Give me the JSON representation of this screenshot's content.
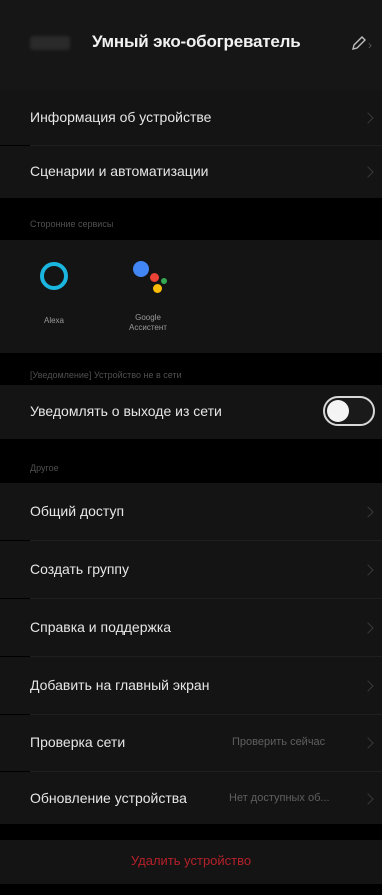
{
  "header": {
    "title": "Умный эко-обогреватель",
    "edit_icon": "pencil-icon",
    "chevron_icon": "chevron-right-icon"
  },
  "menu_top": [
    {
      "label": "Информация об устройстве"
    },
    {
      "label": "Сценарии и автоматизации"
    }
  ],
  "third_party": {
    "section_label": "Сторонние сервисы",
    "services": [
      {
        "name": "Alexa",
        "icon": "alexa-icon"
      },
      {
        "name": "Google\nАссистент",
        "icon": "google-assistant-icon"
      }
    ]
  },
  "notifications": {
    "section_label": "[Уведомление] Устройство не в сети",
    "offline_label": "Уведомлять о выходе из сети",
    "offline_enabled": false
  },
  "other": {
    "section_label": "Другое",
    "items": [
      {
        "label": "Общий доступ",
        "value": ""
      },
      {
        "label": "Создать группу",
        "value": ""
      },
      {
        "label": "Справка и поддержка",
        "value": ""
      },
      {
        "label": "Добавить на главный экран",
        "value": ""
      },
      {
        "label": "Проверка сети",
        "value": "Проверить сейчас"
      },
      {
        "label": "Обновление устройства",
        "value": "Нет доступных об..."
      }
    ]
  },
  "delete_label": "Удалить устройство",
  "colors": {
    "background": "#000000",
    "surface": "#141414",
    "accent_delete": "#b5202a",
    "alexa": "#1ab6e0"
  }
}
